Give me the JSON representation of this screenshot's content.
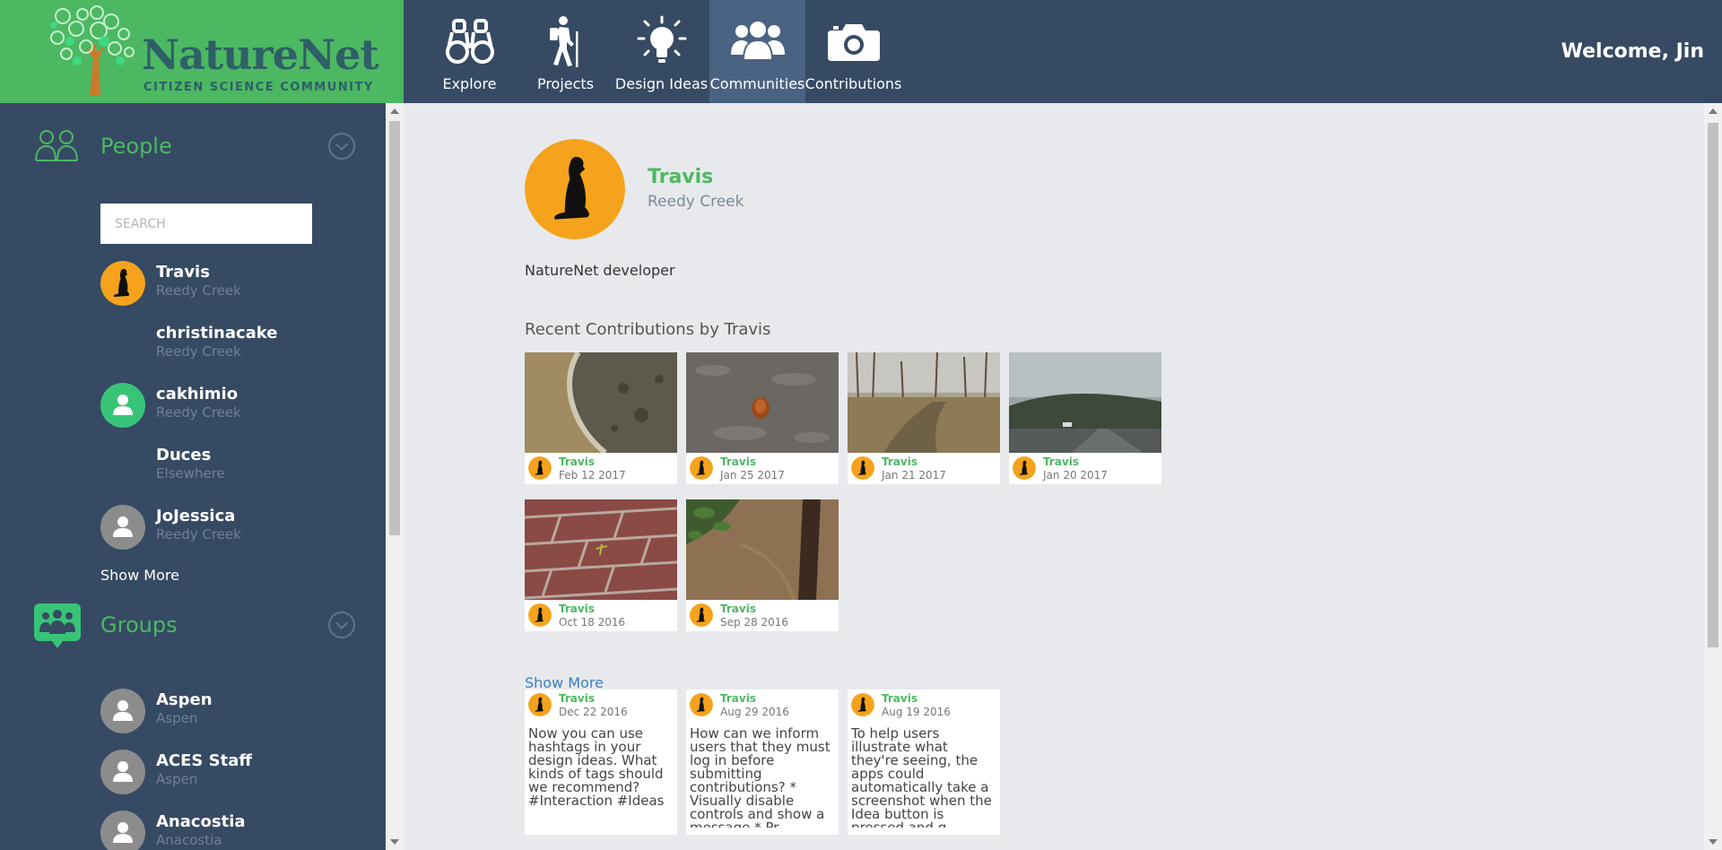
{
  "brand": {
    "name": "NatureNet",
    "tagline": "CITIZEN SCIENCE COMMUNITY"
  },
  "nav": [
    {
      "label": "Explore",
      "icon": "binoculars-icon"
    },
    {
      "label": "Projects",
      "icon": "hiker-icon"
    },
    {
      "label": "Design Ideas",
      "icon": "lightbulb-icon"
    },
    {
      "label": "Communities",
      "icon": "people-icon",
      "active": true
    },
    {
      "label": "Contributions",
      "icon": "camera-icon"
    }
  ],
  "welcome": "Welcome, Jin",
  "sidebar": {
    "people_title": "People",
    "search_placeholder": "SEARCH",
    "people": [
      {
        "name": "Travis",
        "location": "Reedy Creek",
        "avatar": "otter"
      },
      {
        "name": "christinacake",
        "location": "Reedy Creek",
        "avatar": "none"
      },
      {
        "name": "cakhimio",
        "location": "Reedy Creek",
        "avatar": "green-user"
      },
      {
        "name": "Duces",
        "location": "Elsewhere",
        "avatar": "none"
      },
      {
        "name": "JoJessica",
        "location": "Reedy Creek",
        "avatar": "gray-user"
      }
    ],
    "people_show_more": "Show More",
    "groups_title": "Groups",
    "groups": [
      {
        "name": "Aspen",
        "location": "Aspen"
      },
      {
        "name": "ACES Staff",
        "location": "Aspen"
      },
      {
        "name": "Anacostia",
        "location": "Anacostia"
      }
    ]
  },
  "profile": {
    "name": "Travis",
    "location": "Reedy Creek",
    "bio": "NatureNet developer",
    "recent_title": "Recent Contributions by Travis"
  },
  "contributions": [
    {
      "author": "Travis",
      "date": "Feb 12 2017",
      "scene": "rock"
    },
    {
      "author": "Travis",
      "date": "Jan 25 2017",
      "scene": "pinecone"
    },
    {
      "author": "Travis",
      "date": "Jan 21 2017",
      "scene": "field"
    },
    {
      "author": "Travis",
      "date": "Jan 20 2017",
      "scene": "road"
    },
    {
      "author": "Travis",
      "date": "Oct 18 2016",
      "scene": "bricks"
    },
    {
      "author": "Travis",
      "date": "Sep 28 2016",
      "scene": "creek"
    }
  ],
  "show_more": "Show More",
  "ideas": [
    {
      "author": "Travis",
      "date": "Dec 22 2016",
      "text": "Now you can use hashtags in your design ideas. What kinds of tags should we recommend? #Interaction #Ideas"
    },
    {
      "author": "Travis",
      "date": "Aug 29 2016",
      "text": "How can we inform users that they must log in before submitting contributions? * Visually disable controls and show a message * Pr..."
    },
    {
      "author": "Travis",
      "date": "Aug 19 2016",
      "text": "To help users illustrate what they're seeing, the apps could automatically take a screenshot when the Idea button is pressed and g..."
    }
  ],
  "colors": {
    "header": "#364a63",
    "brand_green": "#4cb862",
    "active_tab": "#4b6382",
    "avatar_orange": "#f5a31c"
  }
}
